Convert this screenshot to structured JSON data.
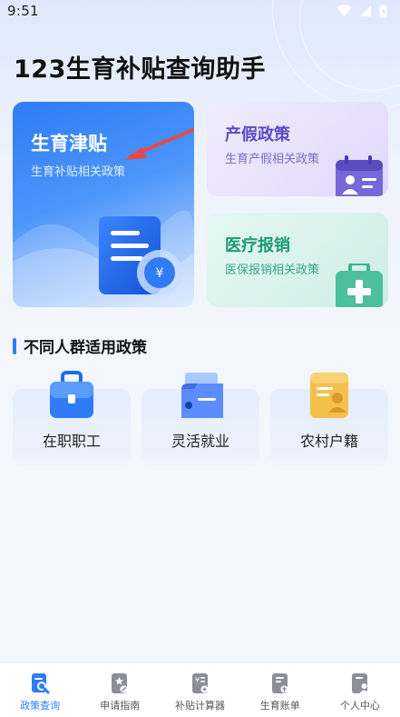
{
  "status_bar": {
    "time": "9:51"
  },
  "page_title": "123生育补贴查询助手",
  "cards": {
    "main": {
      "title": "生育津贴",
      "subtitle": "生育补贴相关政策"
    },
    "maternity_leave": {
      "title": "产假政策",
      "subtitle": "生育产假相关政策"
    },
    "medical": {
      "title": "医疗报销",
      "subtitle": "医保报销相关政策"
    }
  },
  "section": {
    "title": "不同人群适用政策"
  },
  "groups": [
    {
      "label": "在职职工",
      "icon": "briefcase-icon"
    },
    {
      "label": "灵活就业",
      "icon": "folder-icon"
    },
    {
      "label": "农村户籍",
      "icon": "id-card-icon"
    }
  ],
  "tabbar": [
    {
      "label": "政策查询",
      "icon": "search-doc-icon",
      "active": true
    },
    {
      "label": "申请指南",
      "icon": "guide-icon",
      "active": false
    },
    {
      "label": "补贴计算器",
      "icon": "calculator-icon",
      "active": false
    },
    {
      "label": "生育账单",
      "icon": "bill-icon",
      "active": false
    },
    {
      "label": "个人中心",
      "icon": "user-card-icon",
      "active": false
    }
  ],
  "colors": {
    "accent": "#2f7cf6",
    "purple": "#5b4bc4",
    "green": "#1e9a78"
  }
}
